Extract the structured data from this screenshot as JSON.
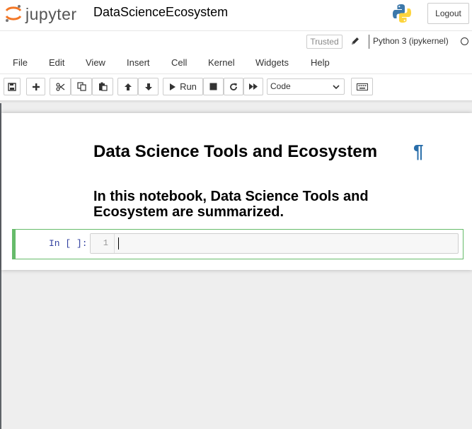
{
  "app": {
    "logo_text": "jupyter",
    "notebook_name": "DataScienceEcosystem",
    "logout_label": "Logout"
  },
  "status": {
    "trusted_label": "Trusted",
    "kernel_name": "Python 3 (ipykernel)",
    "kernel_state": "idle"
  },
  "menu": {
    "items": [
      "File",
      "Edit",
      "View",
      "Insert",
      "Cell",
      "Kernel",
      "Widgets",
      "Help"
    ]
  },
  "toolbar": {
    "buttons": [
      "save-icon",
      "plus-icon",
      "cut-icon",
      "copy-icon",
      "paste-icon",
      "arrow-up-icon",
      "arrow-down-icon",
      "run-icon",
      "stop-icon",
      "restart-icon",
      "fast-forward-icon",
      "keyboard-icon"
    ],
    "run_label": "Run",
    "cell_type": "Code"
  },
  "notebook": {
    "heading1": "Data Science Tools and Ecosystem",
    "anchor_symbol": "¶",
    "heading3": "In this notebook, Data Science Tools and Ecosystem are summarized.",
    "code_prompt": "In [ ]:",
    "line_number": "1"
  },
  "colors": {
    "accent_green": "#66bb6a",
    "anchor_blue": "#296eaa",
    "prompt_blue": "#303f9f"
  }
}
